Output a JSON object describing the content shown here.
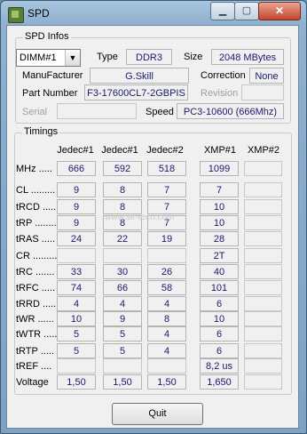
{
  "window": {
    "title": "SPD",
    "minimize": "▁",
    "maximize": "▢",
    "close": "✕",
    "app_icon": "spd-app-icon"
  },
  "spd_infos": {
    "group_label": "SPD Infos",
    "slot_selected": "DIMM#1",
    "type_label": "Type",
    "type_value": "DDR3",
    "size_label": "Size",
    "size_value": "2048 MBytes",
    "manufacturer_label": "ManuFacturer",
    "manufacturer_value": "G.Skill",
    "correction_label": "Correction",
    "correction_value": "None",
    "part_number_label": "Part Number",
    "part_number_value": "F3-17600CL7-2GBPIS",
    "revision_label": "Revision",
    "revision_value": "",
    "serial_label": "Serial",
    "serial_value": "",
    "speed_label": "Speed",
    "speed_value": "PC3-10600 (666Mhz)"
  },
  "timings": {
    "group_label": "Timings",
    "columns": [
      "Jedec#1",
      "Jedec#1",
      "Jedec#2",
      "XMP#1",
      "XMP#2"
    ],
    "rows": [
      {
        "label": "MHz .....",
        "values": [
          "666",
          "592",
          "518",
          "1099",
          ""
        ]
      },
      {
        "label": "CL .........",
        "values": [
          "9",
          "8",
          "7",
          "7",
          ""
        ]
      },
      {
        "label": "tRCD ......",
        "values": [
          "9",
          "8",
          "7",
          "10",
          ""
        ]
      },
      {
        "label": "tRP ........",
        "values": [
          "9",
          "8",
          "7",
          "10",
          ""
        ]
      },
      {
        "label": "tRAS .....",
        "values": [
          "24",
          "22",
          "19",
          "28",
          ""
        ]
      },
      {
        "label": "CR .........",
        "values": [
          "",
          "",
          "",
          "2T",
          ""
        ]
      },
      {
        "label": "tRC .......",
        "values": [
          "33",
          "30",
          "26",
          "40",
          ""
        ]
      },
      {
        "label": "tRFC .....",
        "values": [
          "74",
          "66",
          "58",
          "101",
          ""
        ]
      },
      {
        "label": "tRRD .....",
        "values": [
          "4",
          "4",
          "4",
          "6",
          ""
        ]
      },
      {
        "label": "tWR ......",
        "values": [
          "10",
          "9",
          "8",
          "10",
          ""
        ]
      },
      {
        "label": "tWTR .....",
        "values": [
          "5",
          "5",
          "4",
          "6",
          ""
        ]
      },
      {
        "label": "tRTP .....",
        "values": [
          "5",
          "5",
          "4",
          "6",
          ""
        ]
      },
      {
        "label": "tREF ....",
        "values": [
          "",
          "",
          "",
          "8,2 us",
          ""
        ]
      },
      {
        "label": "Voltage",
        "values": [
          "1,50",
          "1,50",
          "1,50",
          "1,650",
          ""
        ]
      }
    ]
  },
  "watermark": "www.sir-tech.com",
  "quit_label": "Quit"
}
